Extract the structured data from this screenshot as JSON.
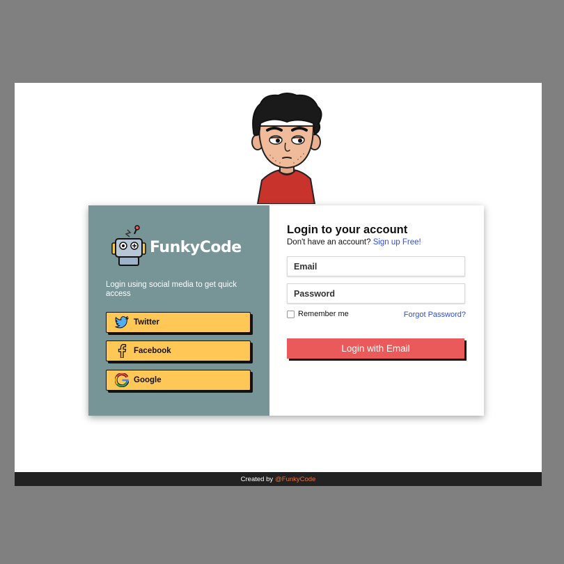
{
  "brand": {
    "name": "FunkyCode",
    "logo_icon": "robot-logo"
  },
  "social": {
    "tagline": "Login using social media to get quick access",
    "buttons": [
      {
        "label": "Twitter",
        "icon": "twitter-icon"
      },
      {
        "label": "Facebook",
        "icon": "facebook-icon"
      },
      {
        "label": "Google",
        "icon": "google-icon"
      }
    ]
  },
  "login": {
    "title": "Login to your account",
    "no_account_text": "Don't have an account?",
    "signup_link": "Sign up Free!",
    "email_placeholder": "Email",
    "email_value": "",
    "password_placeholder": "Password",
    "password_value": "",
    "remember_label": "Remember me",
    "forgot_link": "Forgot Password?",
    "submit_label": "Login with Email"
  },
  "footer": {
    "created_by": "Created by",
    "author_link": "@FunkyCode"
  },
  "colors": {
    "background": "#808080",
    "left_panel": "#779496",
    "social_button": "#fec756",
    "login_button": "#ea5a5a",
    "link": "#2a4fe8",
    "footer_bg": "#222222",
    "footer_link": "#f0703c"
  }
}
